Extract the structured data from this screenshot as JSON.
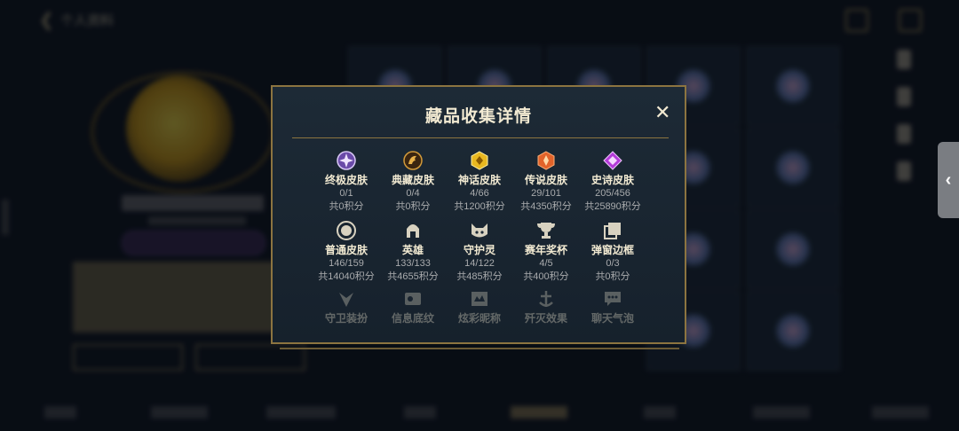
{
  "modal": {
    "title": "藏品收集详情",
    "close_glyph": "✕"
  },
  "collections": [
    {
      "label": "终极皮肤",
      "count": "0/1",
      "points": "共0积分",
      "icon": "ultimate-skin-icon",
      "color": "#c9a6f2"
    },
    {
      "label": "典藏皮肤",
      "count": "0/4",
      "points": "共0积分",
      "icon": "collector-skin-icon",
      "color": "#c88a2a"
    },
    {
      "label": "神话皮肤",
      "count": "4/66",
      "points": "共1200积分",
      "icon": "mythic-skin-icon",
      "color": "#e9b820"
    },
    {
      "label": "传说皮肤",
      "count": "29/101",
      "points": "共4350积分",
      "icon": "legendary-skin-icon",
      "color": "#e2632a"
    },
    {
      "label": "史诗皮肤",
      "count": "205/456",
      "points": "共25890积分",
      "icon": "epic-skin-icon",
      "color": "#b43ad8"
    },
    {
      "label": "普通皮肤",
      "count": "146/159",
      "points": "共14040积分",
      "icon": "normal-skin-icon",
      "color": "#d8d2c0"
    },
    {
      "label": "英雄",
      "count": "133/133",
      "points": "共4655积分",
      "icon": "hero-icon",
      "color": "#d8d2c0"
    },
    {
      "label": "守护灵",
      "count": "14/122",
      "points": "共485积分",
      "icon": "guardian-spirit-icon",
      "color": "#d8d2c0"
    },
    {
      "label": "赛年奖杯",
      "count": "4/5",
      "points": "共400积分",
      "icon": "season-trophy-icon",
      "color": "#d8d2c0"
    },
    {
      "label": "弹窗边框",
      "count": "0/3",
      "points": "共0积分",
      "icon": "popup-frame-icon",
      "color": "#d8d2c0"
    },
    {
      "label": "守卫装扮",
      "icon": "ward-skin-icon",
      "color": "#d8d2c0"
    },
    {
      "label": "信息底纹",
      "icon": "info-shading-icon",
      "color": "#d8d2c0"
    },
    {
      "label": "炫彩昵称",
      "icon": "dazzle-nickname-icon",
      "color": "#d8d2c0"
    },
    {
      "label": "歼灭效果",
      "icon": "annihilation-effect-icon",
      "color": "#d8d2c0"
    },
    {
      "label": "聊天气泡",
      "icon": "chat-bubble-icon",
      "color": "#d8d2c0"
    }
  ],
  "side_handle": {
    "glyph": "‹"
  },
  "background": {
    "back_glyph": "❮",
    "title": "个人资料"
  }
}
